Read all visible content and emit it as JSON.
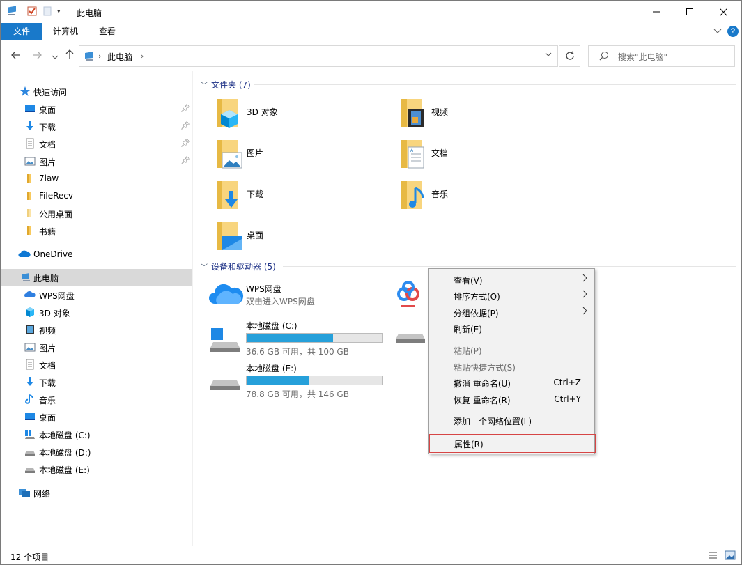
{
  "window": {
    "title": "此电脑",
    "controls": {
      "minimize": "—",
      "maximize": "☐",
      "close": "✕"
    }
  },
  "ribbon": {
    "tabs": [
      {
        "label": "文件",
        "active": true
      },
      {
        "label": "计算机",
        "active": false
      },
      {
        "label": "查看",
        "active": false
      }
    ]
  },
  "nav": {
    "address": "此电脑",
    "search_placeholder": "搜索\"此电脑\""
  },
  "sidebar": {
    "quick_access": {
      "label": "快速访问"
    },
    "quick_items": [
      {
        "label": "桌面",
        "icon": "desktop-icon",
        "pinned": true
      },
      {
        "label": "下载",
        "icon": "download-icon",
        "pinned": true
      },
      {
        "label": "文档",
        "icon": "document-icon",
        "pinned": true
      },
      {
        "label": "图片",
        "icon": "pictures-icon",
        "pinned": true
      },
      {
        "label": "7law",
        "icon": "folder-icon",
        "pinned": false
      },
      {
        "label": "FileRecv",
        "icon": "folder-icon",
        "pinned": false
      },
      {
        "label": "公用桌面",
        "icon": "folder-icon",
        "pinned": false
      },
      {
        "label": "书籍",
        "icon": "folder-icon",
        "pinned": false
      }
    ],
    "onedrive": {
      "label": "OneDrive"
    },
    "this_pc": {
      "label": "此电脑",
      "selected": true
    },
    "pc_items": [
      {
        "label": "WPS网盘",
        "icon": "cloud-icon"
      },
      {
        "label": "3D 对象",
        "icon": "3d-objects-icon"
      },
      {
        "label": "视频",
        "icon": "video-icon"
      },
      {
        "label": "图片",
        "icon": "pictures-icon"
      },
      {
        "label": "文档",
        "icon": "document-icon"
      },
      {
        "label": "下载",
        "icon": "download-icon"
      },
      {
        "label": "音乐",
        "icon": "music-icon"
      },
      {
        "label": "桌面",
        "icon": "desktop-icon"
      },
      {
        "label": "本地磁盘 (C:)",
        "icon": "windows-drive-icon"
      },
      {
        "label": "本地磁盘 (D:)",
        "icon": "drive-icon"
      },
      {
        "label": "本地磁盘 (E:)",
        "icon": "drive-icon"
      }
    ],
    "network": {
      "label": "网络"
    }
  },
  "content": {
    "folders_group": {
      "label": "文件夹 (7)"
    },
    "folders": [
      {
        "label": "3D 对象",
        "icon": "3d-objects-folder-icon"
      },
      {
        "label": "视频",
        "icon": "video-folder-icon"
      },
      {
        "label": "图片",
        "icon": "pictures-folder-icon"
      },
      {
        "label": "文档",
        "icon": "documents-folder-icon"
      },
      {
        "label": "下载",
        "icon": "downloads-folder-icon"
      },
      {
        "label": "音乐",
        "icon": "music-folder-icon"
      },
      {
        "label": "桌面",
        "icon": "desktop-folder-icon"
      }
    ],
    "devices_group": {
      "label": "设备和驱动器 (5)"
    },
    "wps": {
      "name": "WPS网盘",
      "sub": "双击进入WPS网盘"
    },
    "drive_c": {
      "name": "本地磁盘 (C:)",
      "sub": "36.6 GB 可用，共 100 GB",
      "used_fraction": 0.634
    },
    "drive_e": {
      "name": "本地磁盘 (E:)",
      "sub": "78.8 GB 可用，共 146 GB",
      "used_fraction": 0.46
    }
  },
  "context_menu": {
    "items": [
      {
        "label": "查看(V)",
        "submenu": true,
        "disabled": false
      },
      {
        "label": "排序方式(O)",
        "submenu": true,
        "disabled": false
      },
      {
        "label": "分组依据(P)",
        "submenu": true,
        "disabled": false
      },
      {
        "label": "刷新(E)",
        "submenu": false,
        "disabled": false
      },
      {
        "label": "粘贴(P)",
        "submenu": false,
        "disabled": true
      },
      {
        "label": "粘贴快捷方式(S)",
        "submenu": false,
        "disabled": true
      },
      {
        "label": "撤消 重命名(U)",
        "shortcut": "Ctrl+Z",
        "disabled": false
      },
      {
        "label": "恢复 重命名(R)",
        "shortcut": "Ctrl+Y",
        "disabled": false
      },
      {
        "label": "添加一个网络位置(L)",
        "disabled": false
      },
      {
        "label": "属性(R)",
        "disabled": false,
        "highlighted": true
      }
    ],
    "highlight_color": "#d64545"
  },
  "status": {
    "count": "12 个项目"
  },
  "colors": {
    "accent": "#1979ca",
    "drive_bar": "#26a0da",
    "group_header": "#1e3287"
  }
}
